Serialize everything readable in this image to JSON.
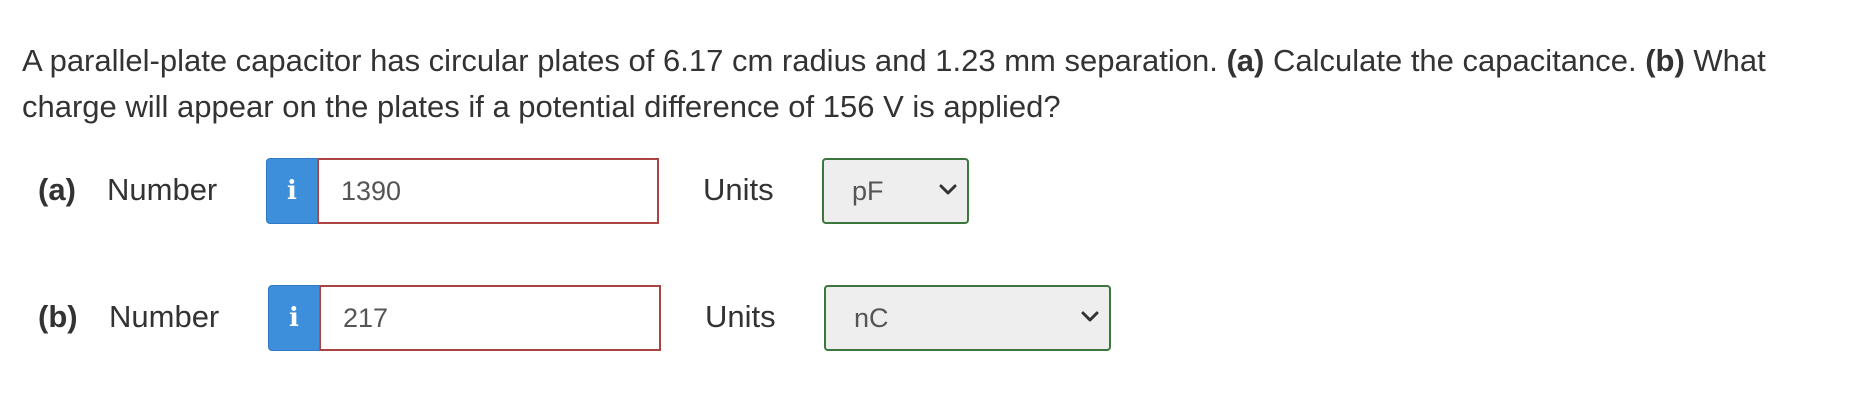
{
  "question": {
    "text_1": "A parallel-plate capacitor has circular plates of 6.17 cm radius and 1.23 mm separation. ",
    "part_a_marker": "(a)",
    "text_2": " Calculate the capacitance. ",
    "part_b_marker": "(b)",
    "text_3": " What charge will appear on the plates if a potential difference of 156 V is applied?"
  },
  "parts": [
    {
      "label": "(a)",
      "number_label": "Number",
      "info_icon": "i",
      "value": "1390",
      "units_label": "Units",
      "unit": "pF"
    },
    {
      "label": "(b)",
      "number_label": "Number",
      "info_icon": "i",
      "value": "217",
      "units_label": "Units",
      "unit": "nC"
    }
  ],
  "colors": {
    "info_button": "#3d8fdc",
    "input_border_incorrect": "#a94442",
    "select_border_correct": "#3c763d"
  }
}
